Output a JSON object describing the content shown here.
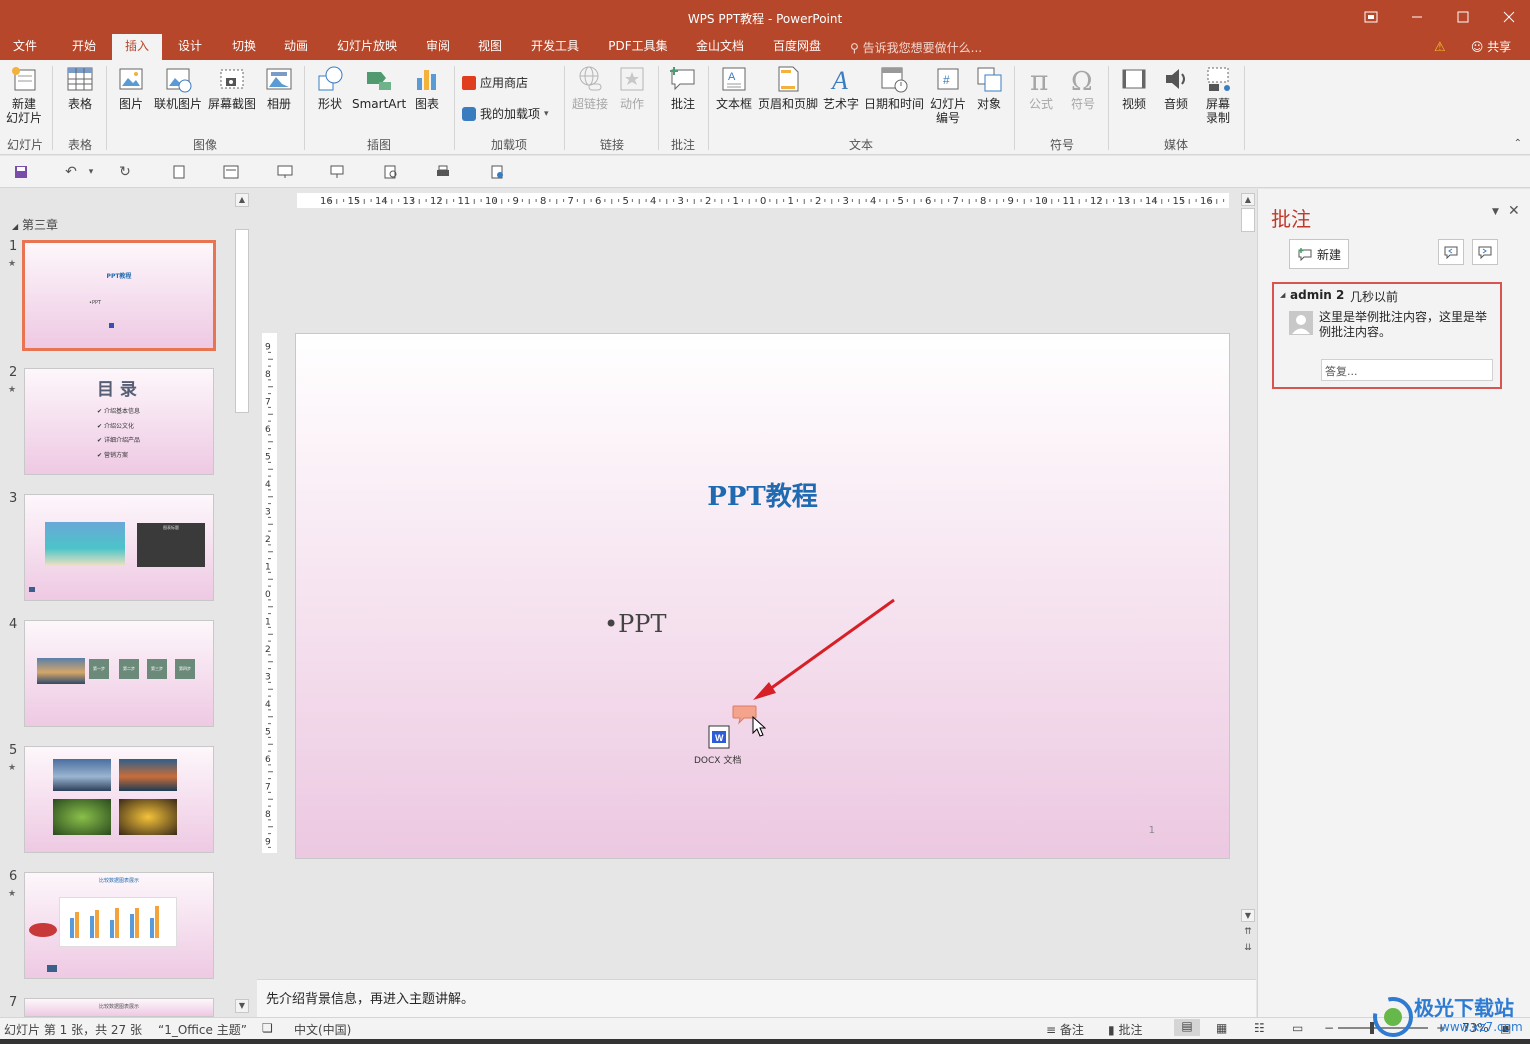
{
  "window": {
    "title": "WPS PPT教程 - PowerPoint",
    "controls": [
      "restore-ribbon",
      "minimize",
      "maximize",
      "close"
    ]
  },
  "menu": {
    "tabs": [
      "文件",
      "开始",
      "插入",
      "设计",
      "切换",
      "动画",
      "幻灯片放映",
      "审阅",
      "视图",
      "开发工具",
      "PDF工具集",
      "金山文档",
      "百度网盘"
    ],
    "active_tab": "插入",
    "tell_me": "告诉我您想要做什么...",
    "share": "共享"
  },
  "ribbon": {
    "buttons": {
      "new_slide": "新建\n幻灯片",
      "table": "表格",
      "picture": "图片",
      "online_picture": "联机图片",
      "screenshot": "屏幕截图",
      "album": "相册",
      "shapes": "形状",
      "smartart": "SmartArt",
      "chart": "图表",
      "app_store": "应用商店",
      "my_addins": "我的加载项",
      "hyperlink": "超链接",
      "action": "动作",
      "comment": "批注",
      "textbox": "文本框",
      "header_footer": "页眉和页脚",
      "wordart": "艺术字",
      "datetime": "日期和时间",
      "slide_number": "幻灯片\n编号",
      "object": "对象",
      "equation": "公式",
      "symbol": "符号",
      "video": "视频",
      "audio": "音频",
      "screen_recording": "屏幕\n录制"
    },
    "groups": {
      "slides": "幻灯片",
      "tables": "表格",
      "images": "图像",
      "illustrations": "插图",
      "addins": "加载项",
      "links": "链接",
      "comments": "批注",
      "text": "文本",
      "symbols": "符号",
      "media": "媒体"
    }
  },
  "slides_panel": {
    "section": "第三章",
    "slides": [
      {
        "num": "1",
        "star": "★",
        "title": "PPT教程"
      },
      {
        "num": "2",
        "star": "★",
        "title": "目 录",
        "items": [
          "介绍基本信息",
          "介绍公文化",
          "详细介绍产品",
          "营销方案"
        ]
      },
      {
        "num": "3",
        "star": "",
        "title": "图表标题"
      },
      {
        "num": "4",
        "star": "",
        "steps": [
          "第一步",
          "第二步",
          "第三步",
          "第四步"
        ]
      },
      {
        "num": "5",
        "star": "★"
      },
      {
        "num": "6",
        "star": "★",
        "title": "比较数据图表展示"
      },
      {
        "num": "7",
        "star": "",
        "title": "比较数据图表展示"
      }
    ]
  },
  "slide": {
    "title": "PPT教程",
    "bullet": "•PPT",
    "doc_label": "DOCX 文档",
    "page_number": "1"
  },
  "notes": "先介绍背景信息，再进入主题讲解。",
  "comments_pane": {
    "title": "批注",
    "new_button": "新建",
    "comment": {
      "author": "admin 2",
      "time": "几秒以前",
      "text": "这里是举例批注内容，这里是举例批注内容。",
      "reply_placeholder": "答复..."
    }
  },
  "status": {
    "slide_info": "幻灯片 第 1 张，共 27 张",
    "theme": "“1_Office 主题”",
    "language": "中文(中国)",
    "notes_btn": "备注",
    "comments_btn": "批注",
    "zoom": "73%"
  },
  "watermark": {
    "text": "极光下载站",
    "url": "www.xz7.com"
  },
  "colors": {
    "accent": "#b7472a",
    "comment_border": "#d9534f",
    "slide_title": "#1f6ab0"
  }
}
